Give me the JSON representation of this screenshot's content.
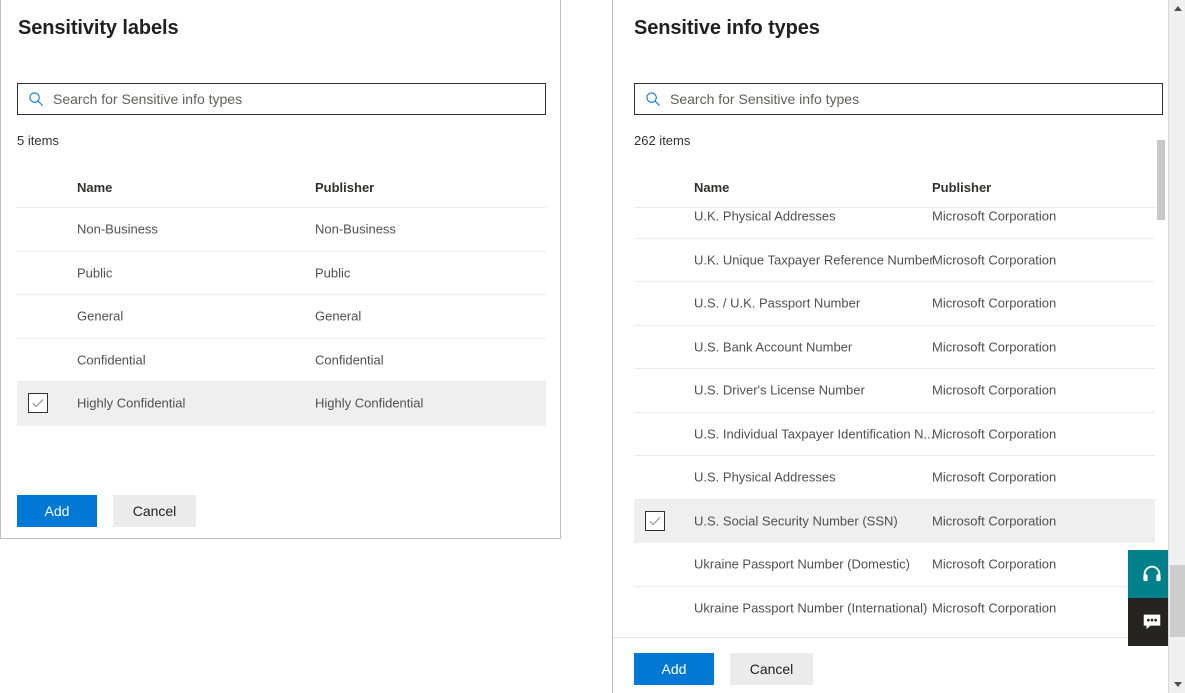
{
  "panels": {
    "left": {
      "title": "Sensitivity labels",
      "search": {
        "placeholder": "Search for Sensitive info types",
        "value": "",
        "icon": "search-icon"
      },
      "item_count": "5 items",
      "columns": {
        "name": "Name",
        "publisher": "Publisher"
      },
      "rows": [
        {
          "name": "Non-Business",
          "publisher": "Non-Business",
          "selected": false
        },
        {
          "name": "Public",
          "publisher": "Public",
          "selected": false
        },
        {
          "name": "General",
          "publisher": "General",
          "selected": false
        },
        {
          "name": "Confidential",
          "publisher": "Confidential",
          "selected": false
        },
        {
          "name": "Highly Confidential",
          "publisher": "Highly Confidential",
          "selected": true
        }
      ],
      "buttons": {
        "add": "Add",
        "cancel": "Cancel"
      }
    },
    "right": {
      "title": "Sensitive info types",
      "search": {
        "placeholder": "Search for Sensitive info types",
        "value": "",
        "icon": "search-icon"
      },
      "item_count": "262 items",
      "columns": {
        "name": "Name",
        "publisher": "Publisher"
      },
      "rows": [
        {
          "name": "U.K. Physical Addresses",
          "publisher": "Microsoft Corporation",
          "selected": false
        },
        {
          "name": "U.K. Unique Taxpayer Reference Number",
          "publisher": "Microsoft Corporation",
          "selected": false
        },
        {
          "name": "U.S. / U.K. Passport Number",
          "publisher": "Microsoft Corporation",
          "selected": false
        },
        {
          "name": "U.S. Bank Account Number",
          "publisher": "Microsoft Corporation",
          "selected": false
        },
        {
          "name": "U.S. Driver's License Number",
          "publisher": "Microsoft Corporation",
          "selected": false
        },
        {
          "name": "U.S. Individual Taxpayer Identification N...",
          "publisher": "Microsoft Corporation",
          "selected": false
        },
        {
          "name": "U.S. Physical Addresses",
          "publisher": "Microsoft Corporation",
          "selected": false
        },
        {
          "name": "U.S. Social Security Number (SSN)",
          "publisher": "Microsoft Corporation",
          "selected": true
        },
        {
          "name": "Ukraine Passport Number (Domestic)",
          "publisher": "Microsoft Corporation",
          "selected": false
        },
        {
          "name": "Ukraine Passport Number (International)",
          "publisher": "Microsoft Corporation",
          "selected": false
        }
      ],
      "buttons": {
        "add": "Add",
        "cancel": "Cancel"
      }
    }
  },
  "help_widgets": [
    {
      "name": "support-headset-icon",
      "color": "#00808b"
    },
    {
      "name": "feedback-chat-icon",
      "color": "#252423"
    }
  ],
  "colors": {
    "accent": "#0078d4",
    "selected_row": "#efefef",
    "support_teal": "#00808b",
    "feedback_dark": "#252423",
    "border": "#bfbfbf",
    "row_divider": "#ebebeb"
  }
}
